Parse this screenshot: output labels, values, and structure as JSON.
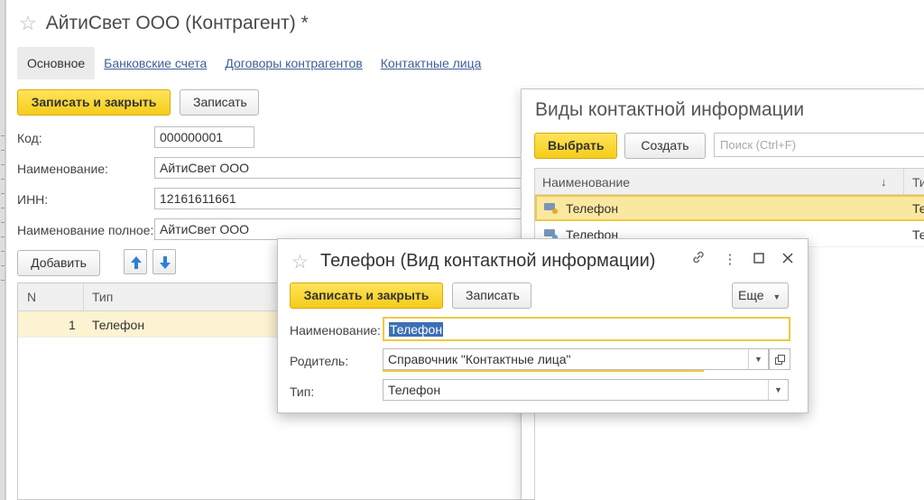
{
  "main": {
    "title": "АйтиСвет ООО (Контрагент) *",
    "tabs": [
      "Основное",
      "Банковские счета",
      "Договоры контрагентов",
      "Контактные лица"
    ],
    "save_close_label": "Записать и закрыть",
    "save_label": "Записать",
    "fields": {
      "code_label": "Код:",
      "code_value": "000000001",
      "name_label": "Наименование:",
      "name_value": "АйтиСвет ООО",
      "inn_label": "ИНН:",
      "inn_value": "12161611661",
      "fullname_label": "Наименование полное:",
      "fullname_value": "АйтиСвет ООО"
    },
    "add_label": "Добавить",
    "table": {
      "columns": [
        "N",
        "Тип"
      ],
      "rows": [
        {
          "n": "1",
          "type": "Телефон"
        }
      ]
    }
  },
  "selector": {
    "title": "Виды контактной информации",
    "select_label": "Выбрать",
    "create_label": "Создать",
    "search_placeholder": "Поиск (Ctrl+F)",
    "columns": [
      "Наименование",
      "Ти"
    ],
    "sort_indicator": "↓",
    "rows": [
      {
        "name": "Телефон",
        "type": "Те"
      },
      {
        "name": "Телефон",
        "type": "Те"
      }
    ]
  },
  "dialog": {
    "title": "Телефон (Вид контактной информации)",
    "save_close_label": "Записать и закрыть",
    "save_label": "Записать",
    "more_label": "Еще",
    "name_label": "Наименование:",
    "name_value": "Телефон",
    "parent_label": "Родитель:",
    "parent_value": "Справочник \"Контактные лица\"",
    "type_label": "Тип:",
    "type_value": "Телефон"
  },
  "colors": {
    "accent_yellow": "#f5cc1a",
    "link_blue": "#3e5f96",
    "row_highlight": "#fcf3d2",
    "text_selection": "#3d6fb5"
  },
  "icons": [
    "star-icon",
    "arrow-up-icon",
    "arrow-down-icon",
    "link-icon",
    "more-vertical-icon",
    "maximize-icon",
    "close-icon",
    "dropdown-arrow-icon",
    "open-form-icon",
    "catalog-item-icon"
  ]
}
